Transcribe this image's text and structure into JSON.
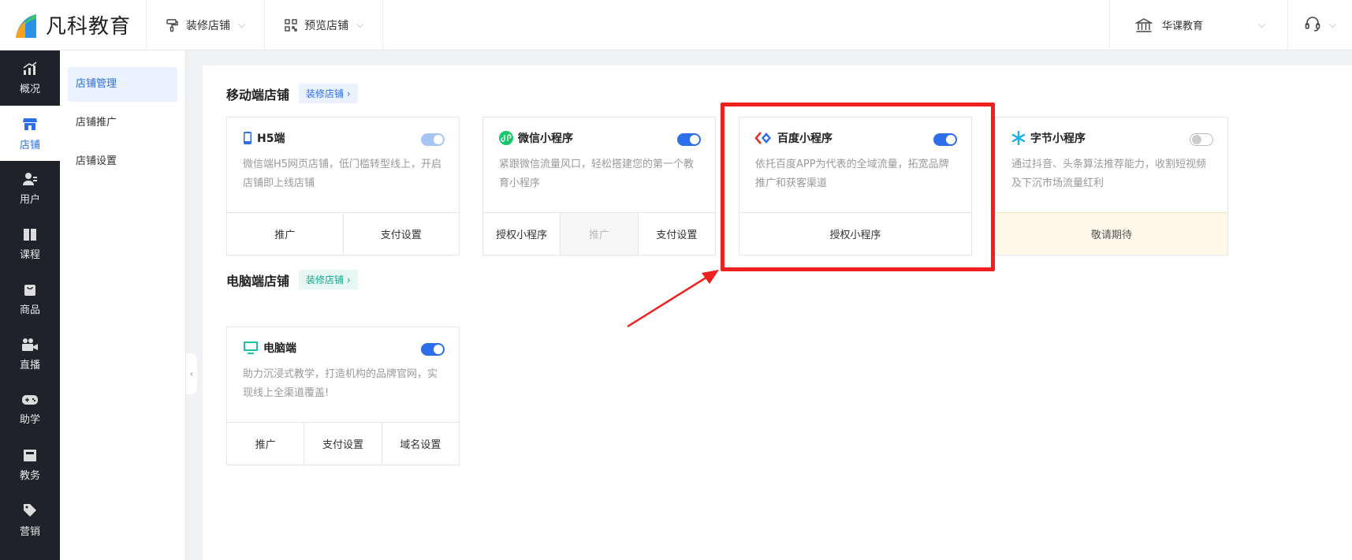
{
  "brand": {
    "name": "凡科教育"
  },
  "topbar": {
    "decorate_store": "装修店铺",
    "preview_store": "预览店铺",
    "org_name": "华课教育"
  },
  "nav": [
    {
      "label": "概况",
      "icon": "chart-trend-icon"
    },
    {
      "label": "店铺",
      "icon": "store-icon"
    },
    {
      "label": "用户",
      "icon": "users-icon"
    },
    {
      "label": "课程",
      "icon": "book-icon"
    },
    {
      "label": "商品",
      "icon": "bag-icon"
    },
    {
      "label": "直播",
      "icon": "video-camera-icon"
    },
    {
      "label": "助学",
      "icon": "gamepad-icon"
    },
    {
      "label": "教务",
      "icon": "calendar-icon"
    },
    {
      "label": "营销",
      "icon": "tag-icon"
    }
  ],
  "subnav": [
    "店铺管理",
    "店铺推广",
    "店铺设置"
  ],
  "mobile_section": {
    "title": "移动端店铺",
    "button": "装修店铺"
  },
  "pc_section": {
    "title": "电脑端店铺",
    "button": "装修店铺"
  },
  "cards": {
    "h5": {
      "title": "H5端",
      "desc": "微信端H5网页店铺，低门槛转型线上，开启店铺即上线店铺",
      "actions": [
        "推广",
        "支付设置"
      ],
      "toggle": "on-light"
    },
    "wechat": {
      "title": "微信小程序",
      "desc": "紧跟微信流量风口，轻松搭建您的第一个教育小程序",
      "actions": [
        "授权小程序",
        "推广",
        "支付设置"
      ],
      "toggle": "on"
    },
    "baidu": {
      "title": "百度小程序",
      "desc": "依托百度APP为代表的全域流量，拓宽品牌推广和获客渠道",
      "actions": [
        "授权小程序"
      ],
      "toggle": "on"
    },
    "bytedance": {
      "title": "字节小程序",
      "desc": "通过抖音、头条算法推荐能力，收割短视频及下沉市场流量红利",
      "actions": [
        "敬请期待"
      ],
      "toggle": "off"
    },
    "pc": {
      "title": "电脑端",
      "desc": "助力沉浸式教学，打造机构的品牌官网，实现线上全渠道覆盖!",
      "actions": [
        "推广",
        "支付设置",
        "域名设置"
      ],
      "toggle": "on"
    }
  },
  "colors": {
    "accent": "#2c6fe8",
    "highlight": "#ee2020",
    "nav_bg": "#1f2329"
  }
}
